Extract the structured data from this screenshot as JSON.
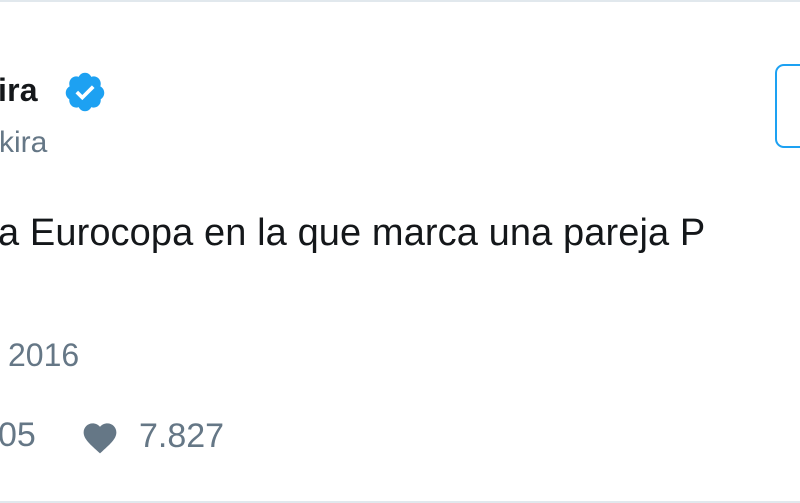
{
  "tweet": {
    "display_name": "ira",
    "handle": "kira",
    "text": "a Eurocopa en la que marca una pareja P",
    "timestamp": "2016",
    "follow_label": ""
  },
  "stats": {
    "retweets": "05",
    "likes": "7.827"
  },
  "colors": {
    "verified": "#1da1f2",
    "muted_text": "#657786",
    "primary_text": "#14171a",
    "border": "#e1e8ed",
    "heart": "#657786"
  },
  "icons": {
    "verified": "verified-badge-icon",
    "like": "heart-icon"
  }
}
